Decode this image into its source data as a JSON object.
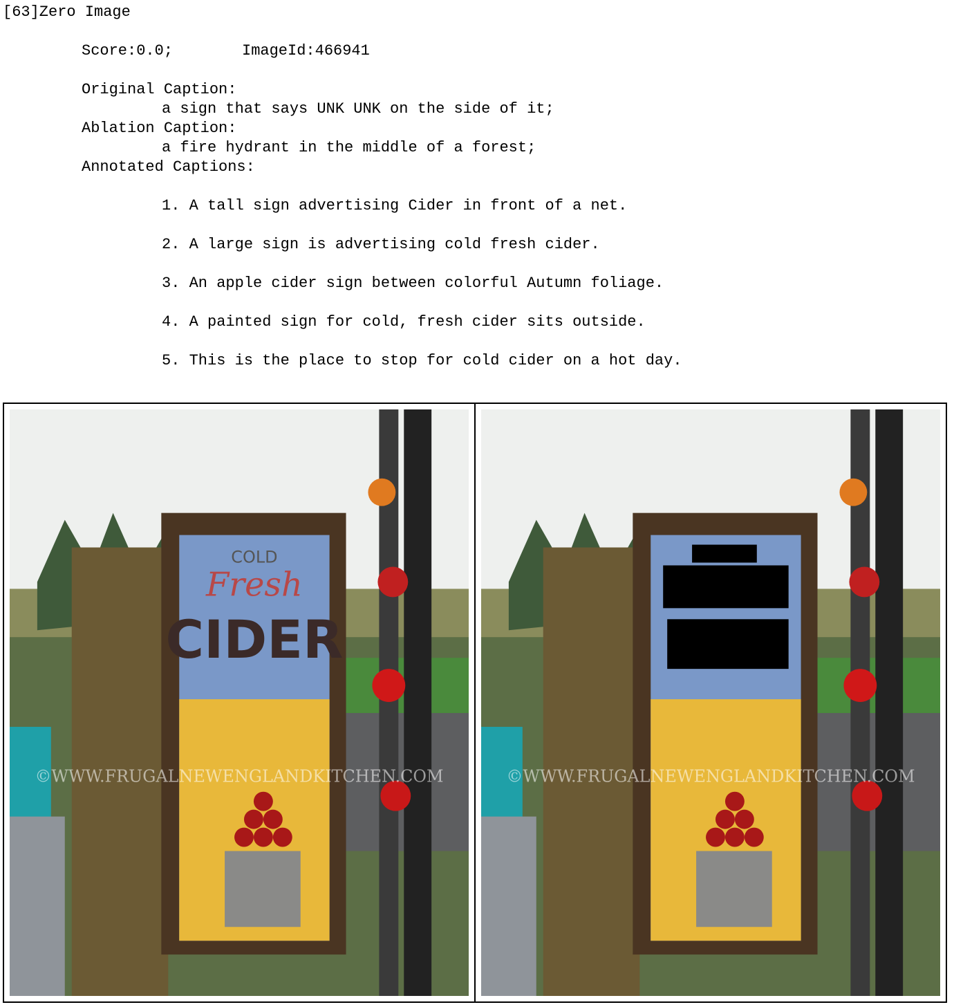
{
  "header": {
    "title": "[63]Zero Image"
  },
  "meta": {
    "score": "Score:0.0;",
    "image_id": "ImageId:466941"
  },
  "original": {
    "label": "Original Caption:",
    "text": "a sign that says UNK UNK on the side of it;"
  },
  "ablation": {
    "label": "Ablation Caption:",
    "text": "a fire hydrant in the middle of a forest;"
  },
  "annotated": {
    "label": "Annotated Captions:",
    "items": [
      "1. A tall sign advertising Cider in front of a net.",
      "2. A large sign is advertising cold fresh cider.",
      "3. An apple cider sign between colorful Autumn foliage.",
      "4. A painted sign for cold, fresh cider sits outside.",
      "5. This is the place to stop for cold cider on a hot day."
    ]
  },
  "figure": {
    "sign_words": [
      "COLD",
      "Fresh",
      "CIDER"
    ],
    "watermark": "©WWW.FRUGALNEWENGLANDKITCHEN.COM"
  }
}
